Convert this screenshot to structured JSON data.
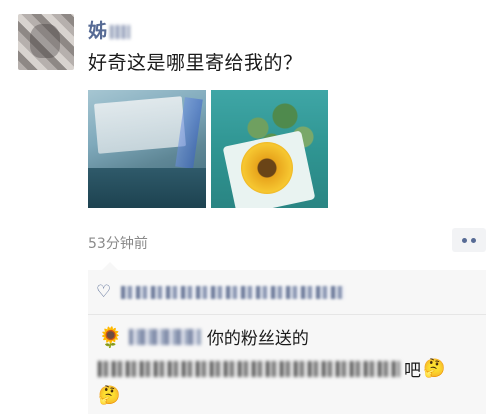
{
  "post": {
    "author_name": "姊",
    "text": "好奇这是哪里寄给我的？",
    "time": "53分钟前"
  },
  "icons": {
    "more": "more-dots-icon",
    "like": "heart-outline-icon",
    "sunflower": "sunflower-emoji",
    "face": "thinking-face-emoji"
  },
  "comment": {
    "line1_text": "你的粉丝送的",
    "line2_tail": "吧",
    "sun_emoji": "🌻",
    "face_emoji": "🤔"
  },
  "colors": {
    "name_link": "#576b95",
    "comment_bg": "#f7f7f7",
    "time_gray": "#8a8a8a"
  }
}
